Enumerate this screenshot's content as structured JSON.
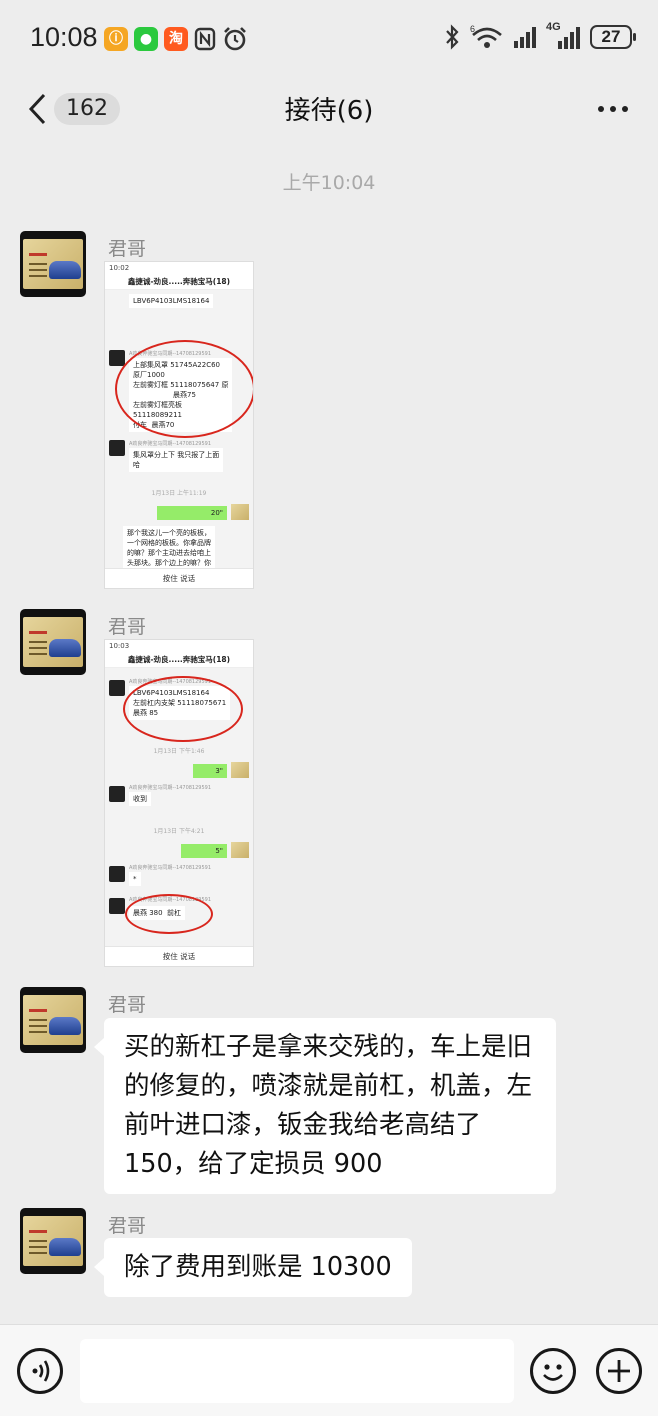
{
  "status_bar": {
    "time": "10:08",
    "network": "4G",
    "wifi_badge": "6",
    "battery": "27",
    "icons": [
      "app-orange-icon",
      "wechat-icon",
      "taobao-icon",
      "nfc-icon",
      "alarm-icon",
      "bluetooth-icon",
      "wifi-icon",
      "signal-icon",
      "battery-icon"
    ]
  },
  "nav": {
    "unread_count": "162",
    "title": "接待(6)"
  },
  "chat": {
    "time_divider": "上午10:04",
    "sender": "君哥",
    "image_messages": [
      {
        "status_time": "10:02",
        "title": "鑫捷诚-劲良.....奔驰宝马(18)",
        "messages": [
          {
            "type": "text",
            "text": "LBV6P4103LMS18164"
          },
          {
            "type": "sender",
            "text": "A劲良奔驰宝马同期--14708129591"
          },
          {
            "type": "text",
            "text": "上部集风罩 51745A22C60\n原厂1000\n左前雾灯框 51118075647 原\n                  晨燕75\n左前雾灯框亮板\n51118089211\n付车  晨燕70"
          },
          {
            "type": "sender",
            "text": "A劲良奔驰宝马同期--14708129591"
          },
          {
            "type": "text",
            "text": "集风罩分上下 我只报了上面\n哈"
          },
          {
            "type": "time",
            "text": "1月13日 上午11:19"
          },
          {
            "type": "voice",
            "text": "20\""
          },
          {
            "type": "text",
            "text": "那个我这儿一个亮的板板，\n一个网格的板板。你拿品牌\n的嘛？那个主动进去给咱上\n头那块。那个边上的嘛？你\n报价拿出来给个呗。我看一"
          }
        ],
        "footer": "按住 说话"
      },
      {
        "status_time": "10:03",
        "title": "鑫捷诚-劲良.....奔驰宝马(18)",
        "messages": [
          {
            "type": "sender",
            "text": "A劲良奔驰宝马同期--14708129591"
          },
          {
            "type": "text",
            "text": "LBV6P4103LMS18164\n左前杠内支架 51118075671\n晨燕 85"
          },
          {
            "type": "time",
            "text": "1月13日 下午1:46"
          },
          {
            "type": "voice",
            "text": "3\""
          },
          {
            "type": "sender",
            "text": "A劲良奔驰宝马同期--14708129591"
          },
          {
            "type": "text",
            "text": "收到"
          },
          {
            "type": "time",
            "text": "1月13日 下午4:21"
          },
          {
            "type": "voice",
            "text": "5\""
          },
          {
            "type": "sender",
            "text": "A劲良奔驰宝马同期--14708129591"
          },
          {
            "type": "text",
            "text": "*"
          },
          {
            "type": "sender",
            "text": "A劲良奔驰宝马同期--14708129591"
          },
          {
            "type": "text",
            "text": "晨燕 380  前杠"
          }
        ],
        "footer": "按住 说话"
      }
    ],
    "text_messages": [
      "买的新杠子是拿来交残的，车上是旧的修复的，喷漆就是前杠，机盖，左前叶进口漆，钣金我给老高结了 150，给了定损员 900",
      "除了费用到账是 10300"
    ]
  },
  "input_bar": {
    "icons": [
      "voice-icon",
      "emoji-icon",
      "plus-icon"
    ]
  }
}
